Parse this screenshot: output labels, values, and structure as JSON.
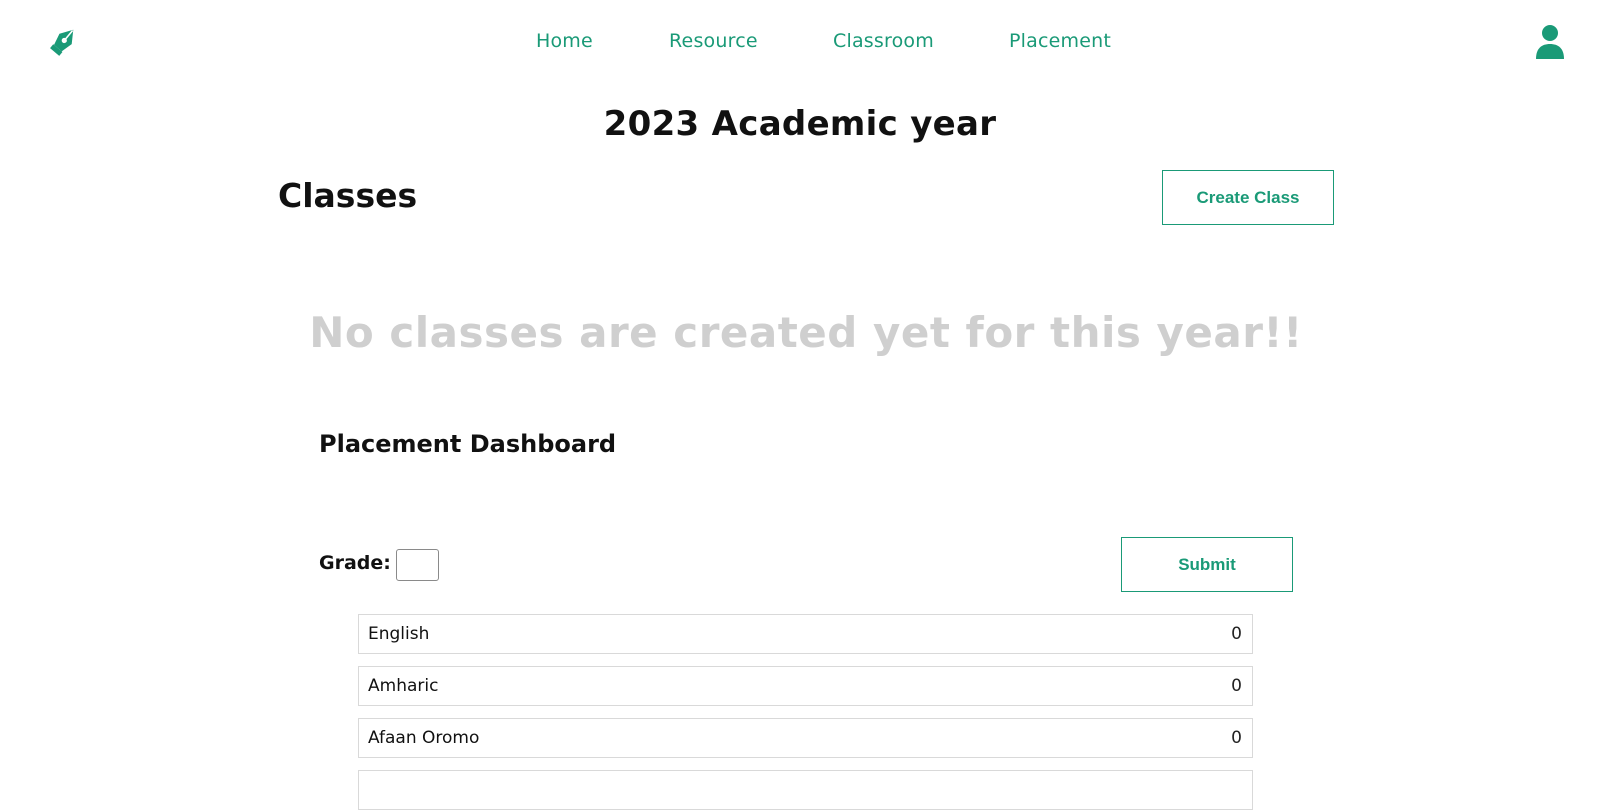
{
  "brand": {
    "logo_icon": "pen-nib-icon",
    "accent_color": "#1a9a77"
  },
  "nav": {
    "items": [
      {
        "label": "Home"
      },
      {
        "label": "Resource"
      },
      {
        "label": "Classroom"
      },
      {
        "label": "Placement"
      }
    ],
    "user_icon": "user-icon"
  },
  "page": {
    "title": "2023 Academic year"
  },
  "classes": {
    "title": "Classes",
    "create_label": "Create Class",
    "empty_message": "No classes are created yet for this year!!"
  },
  "placement": {
    "title": "Placement Dashboard",
    "grade_label": "Grade:",
    "grade_value": "",
    "submit_label": "Submit",
    "subjects": [
      {
        "name": "English",
        "value": "0"
      },
      {
        "name": "Amharic",
        "value": "0"
      },
      {
        "name": "Afaan Oromo",
        "value": "0"
      }
    ]
  }
}
